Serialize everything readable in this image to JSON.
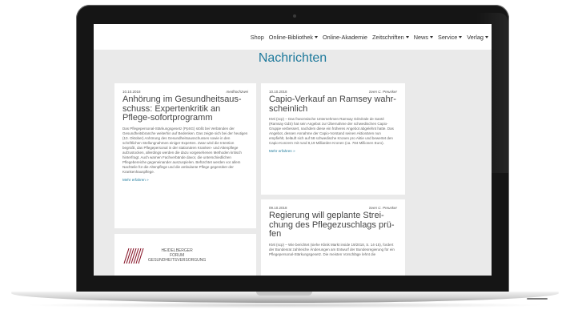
{
  "nav": {
    "items": [
      {
        "label": "Shop",
        "dropdown": false
      },
      {
        "label": "Online-Bibliothek",
        "dropdown": true
      },
      {
        "label": "Online-Akademie",
        "dropdown": false
      },
      {
        "label": "Zeitschriften",
        "dropdown": true
      },
      {
        "label": "News",
        "dropdown": true
      },
      {
        "label": "Service",
        "dropdown": true
      },
      {
        "label": "Verlag",
        "dropdown": true
      }
    ]
  },
  "page": {
    "title": "Nachrichten"
  },
  "articles": [
    {
      "date": "10.10.2018",
      "author": "medhochzwei",
      "title": "Anhörung im Gesundheitsaus-schuss: Expertenkritik an Pflege-sofortprogramm",
      "body": "Das Pflegepersonal-Stärkungsgesetz (PpSG) stößt bei Verbänden der Gesundheitsbranche weiterhin auf Bedenken. Das zeigte sich bei der heutigen (10. Oktober) Anhörung des Gesundheitsausschusses sowie in den schriftlichen Stellungnahmen einiger Experten. Zwar wird die Intention begrüßt, das Pflegepersonal in der stationären Kranken- und Altenpflege aufzustocken, allerdings werden die dazu vorgesehenen Methoden kritisch hinterfragt. Auch warnen Fachverbände davor, die unterschiedlichen Pflegebereiche gegeneinander auszuspielen. Befürchtet werden vor allem Nachteile für die Altenpflege und die ambulante Pflege gegenüber der Krankenhauspflege.",
      "more": "Mehr erfahren »"
    },
    {
      "date": "10.10.2018",
      "author": "Sven C. Preusker",
      "title": "Capio-Verkauf an Ramsey wahr-scheinlich",
      "body": "KMi (scp) – Das französische Unternehmen Ramsay Générale de Santé (Ramsay GdS) hat sein Angebot zur Übernahme der schwedischen Capio-Gruppe verbessert, nachdem diese ein früheres Angebot abgelehnt hatte. Das Angebot, dessen Annahme der Capio-Vorstand seinen Aktionären nun empfiehlt, beläuft sich auf 58 schwedische Kronen pro Aktie und bewertet den Capio-Konzern mit rund 8,19 Milliarden Kronen (ca. 784 Millionen Euro).",
      "more": "Mehr erfahren »"
    },
    {
      "date": "09.10.2018",
      "author": "Sven C. Preusker",
      "title": "Regierung will geplante Strei-chung des Pflegezuschlags prü-fen",
      "body": "KMi (scp) – Wie berichtet (siehe Klinik Markt inside 19/2018, S. 14-15), fordert der Bundesrat zahlreiche Änderungen am Entwurf der Bundesregierung für ein Pflegepersonal-Stärkungsgesetz. Die meisten Vorschläge lehnt die"
    }
  ],
  "logo": {
    "line1": "HEIDELBERGER",
    "line2": "FORUM",
    "line3": "GESUNDHEITSVERSORGUNG",
    "color": "#8a1b2e"
  },
  "colors": {
    "accent": "#1f7a9c",
    "background": "#eaeaea"
  }
}
